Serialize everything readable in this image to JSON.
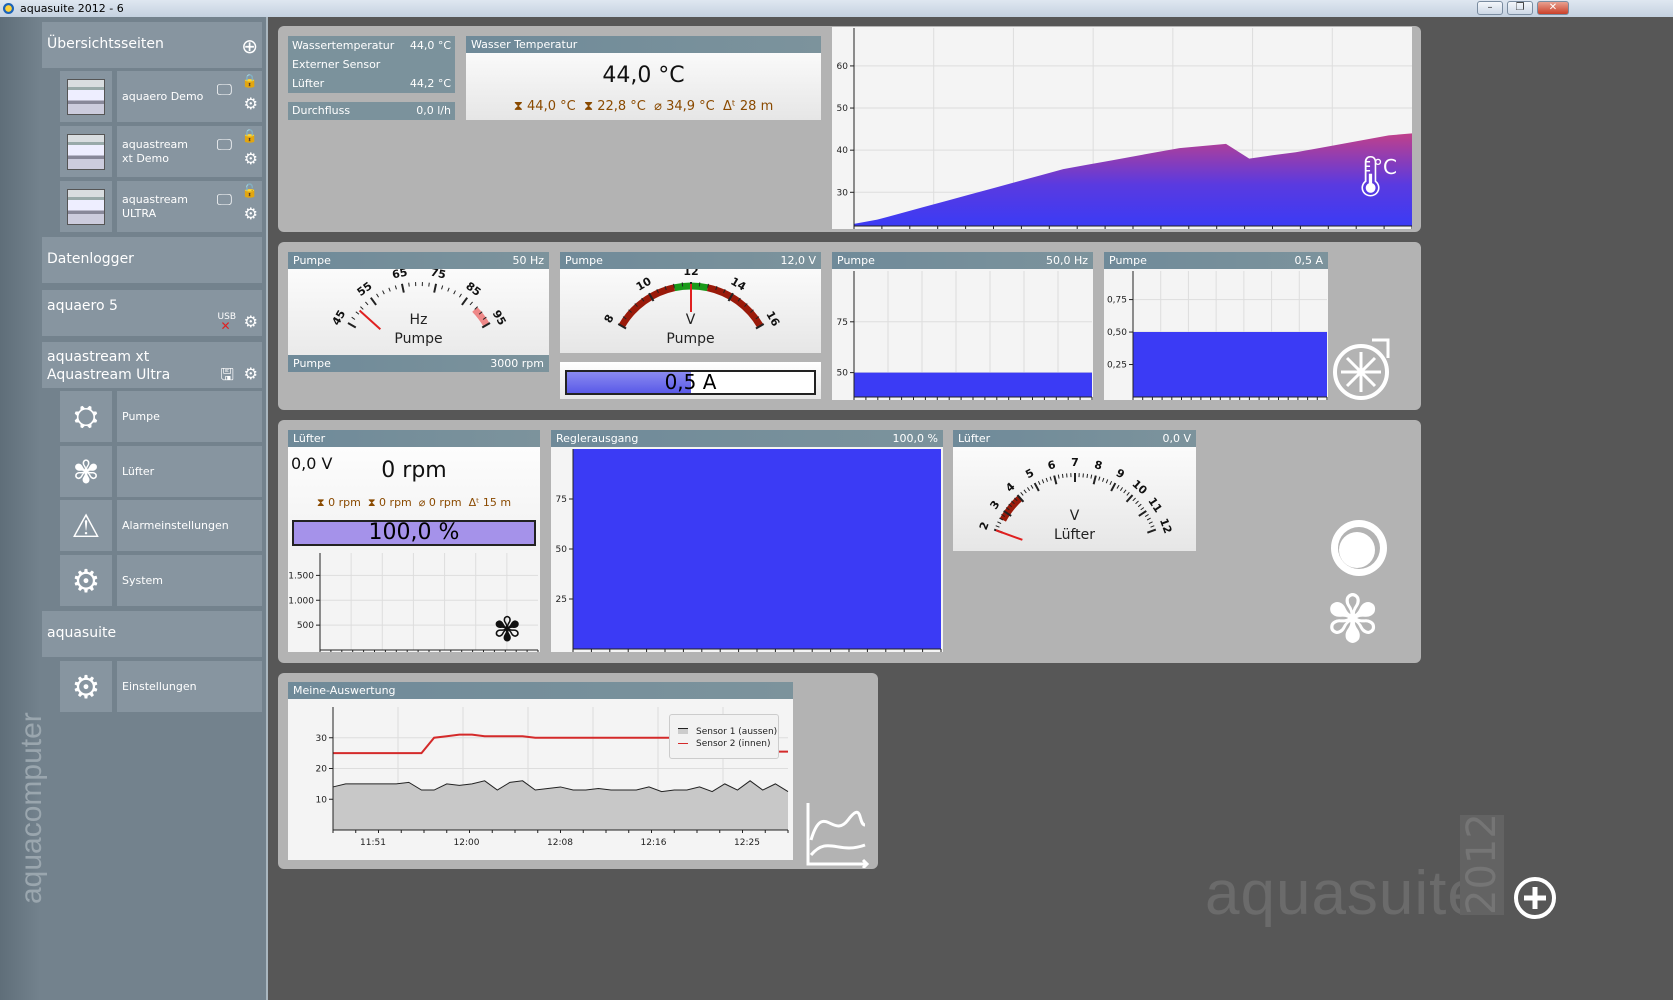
{
  "window": {
    "title": "aquasuite 2012 - 6",
    "min": "–",
    "max": "❐",
    "close": "✕"
  },
  "sidebar": {
    "overview": "Übersichtsseiten",
    "pages": [
      {
        "label": "aquaero Demo"
      },
      {
        "label": "aquastream xt Demo"
      },
      {
        "label": "aquastream ULTRA"
      }
    ],
    "datalogger": "Datenlogger",
    "aquaero": "aquaero 5",
    "usb": "USB",
    "aquastream": "aquastream xt Aquastream Ultra",
    "devices": [
      {
        "label": "Pumpe"
      },
      {
        "label": "Lüfter"
      },
      {
        "label": "Alarmeinstellungen"
      },
      {
        "label": "System"
      }
    ],
    "aquasuite": "aquasuite",
    "settings": "Einstellungen",
    "brand": "aquacomputer"
  },
  "sensors": {
    "rows": [
      {
        "label": "Wassertemperatur",
        "value": "44,0 °C"
      },
      {
        "label": "Externer Sensor",
        "value": ""
      },
      {
        "label": "Lüfter",
        "value": "44,2 °C"
      }
    ],
    "flow": {
      "label": "Durchfluss",
      "value": "0,0 l/h"
    }
  },
  "water": {
    "title": "Wasser Temperatur",
    "value": "44,0 °C",
    "max": "44,0 °C",
    "min": "22,8 °C",
    "avg": "34,9 °C",
    "dt": "28 m",
    "unit_icon": "°C"
  },
  "pump_gauge": {
    "title": "Pumpe",
    "value": "50 Hz",
    "unit": "Hz",
    "label": "Pumpe",
    "ticks": [
      "45",
      "55",
      "65",
      "75",
      "85",
      "95"
    ],
    "footer_label": "Pumpe",
    "footer_value": "3000 rpm",
    "needle": 50
  },
  "volt_gauge": {
    "title": "Pumpe",
    "value": "12,0 V",
    "unit": "V",
    "label": "Pumpe",
    "ticks": [
      "8",
      "10",
      "12",
      "14",
      "16"
    ],
    "needle": 12
  },
  "current_bar": {
    "value": "0,5 A",
    "fill": 0.5
  },
  "pump_hz_chart": {
    "title": "Pumpe",
    "value": "50,0 Hz"
  },
  "pump_a_chart": {
    "title": "Pumpe",
    "value": "0,5 A"
  },
  "fan": {
    "title": "Lüfter",
    "voltage": "0,0 V",
    "rpm": "0 rpm",
    "max": "0 rpm",
    "min": "0 rpm",
    "avg": "0 rpm",
    "dt": "15 m",
    "percent": "100,0 %",
    "fill": 1.0
  },
  "controller": {
    "title": "Reglerausgang",
    "value": "100,0 %"
  },
  "fan_gauge": {
    "title": "Lüfter",
    "value": "0,0 V",
    "unit": "V",
    "label": "Lüfter",
    "ticks": [
      "2",
      "3",
      "4",
      "5",
      "6",
      "7",
      "8",
      "9",
      "10",
      "11",
      "12"
    ],
    "needle": 0
  },
  "analysis": {
    "title": "Meine-Auswertung",
    "legend": [
      "Sensor 1 (aussen)",
      "Sensor 2 (innen)"
    ]
  },
  "footer": {
    "brand": "aquasuite",
    "year": "2012"
  },
  "colors": {
    "header": "#7b929c",
    "fill": "#3b3bf5",
    "magenta": "#c0408a",
    "red": "#d42a2a"
  },
  "chart_data": [
    {
      "type": "area",
      "name": "water-temp",
      "ylim": [
        22,
        69
      ],
      "yticks": [
        "30",
        "40",
        "50",
        "60"
      ],
      "ytickvals": [
        30,
        40,
        50,
        60
      ],
      "series": [
        {
          "name": "Wasser Temperatur",
          "values": [
            22.5,
            23.5,
            25,
            26.5,
            28,
            29.5,
            31,
            32.5,
            34,
            35.5,
            36.5,
            37.5,
            38.5,
            39.5,
            40.5,
            41,
            41.5,
            38,
            38.8,
            39.5,
            40.5,
            41.5,
            42.5,
            43.5,
            44
          ]
        }
      ]
    },
    {
      "type": "area",
      "name": "pump-hz",
      "ylim": [
        38,
        100
      ],
      "yticks": [
        "50",
        "75"
      ],
      "ytickvals": [
        50,
        75
      ],
      "series": [
        {
          "name": "Pumpe Hz",
          "values": [
            50,
            50,
            50,
            50
          ]
        }
      ]
    },
    {
      "type": "area",
      "name": "pump-a",
      "ylim": [
        0,
        0.97
      ],
      "yticks": [
        "0,25",
        "0,50",
        "0,75"
      ],
      "ytickvals": [
        0.25,
        0.5,
        0.75
      ],
      "series": [
        {
          "name": "Pumpe A",
          "values": [
            0.5,
            0.5,
            0.5,
            0.5
          ]
        }
      ]
    },
    {
      "type": "area",
      "name": "fan-rpm",
      "ylim": [
        0,
        1950
      ],
      "yticks": [
        "500",
        "1.000",
        "1.500"
      ],
      "ytickvals": [
        500,
        1000,
        1500
      ],
      "series": [
        {
          "name": "Lüfter rpm",
          "values": [
            0,
            0
          ]
        }
      ]
    },
    {
      "type": "area",
      "name": "controller",
      "ylim": [
        0,
        100
      ],
      "yticks": [
        "25",
        "50",
        "75"
      ],
      "ytickvals": [
        25,
        50,
        75
      ],
      "series": [
        {
          "name": "Reglerausgang",
          "values": [
            100,
            100
          ]
        }
      ]
    },
    {
      "type": "line",
      "name": "analysis",
      "ylim": [
        0,
        40
      ],
      "yticks": [
        "10",
        "20",
        "30"
      ],
      "ytickvals": [
        10,
        20,
        30
      ],
      "xticks": [
        "11:51",
        "12:00",
        "12:08",
        "12:16",
        "12:25"
      ],
      "series": [
        {
          "name": "Sensor 1 (aussen)",
          "values": [
            14,
            15,
            15,
            15,
            15,
            15,
            15.5,
            13,
            13,
            15,
            14.5,
            15,
            16,
            13,
            15.5,
            16,
            13,
            13.5,
            14,
            13,
            13,
            13.5,
            13,
            13,
            13,
            14,
            12.5,
            13,
            13,
            14,
            12.5,
            15,
            13,
            16,
            13,
            15,
            12.5
          ]
        },
        {
          "name": "Sensor 2 (innen)",
          "values": [
            25,
            25,
            25,
            25,
            25,
            25,
            25,
            25,
            30,
            30.5,
            31,
            31,
            30.5,
            30.5,
            30.5,
            30.5,
            30,
            30,
            30,
            30,
            30,
            30,
            30,
            30,
            30,
            30,
            30,
            30,
            30,
            30,
            25.5,
            25.5,
            25.5,
            25.5,
            25.5,
            25.5,
            25.5
          ]
        }
      ]
    }
  ]
}
